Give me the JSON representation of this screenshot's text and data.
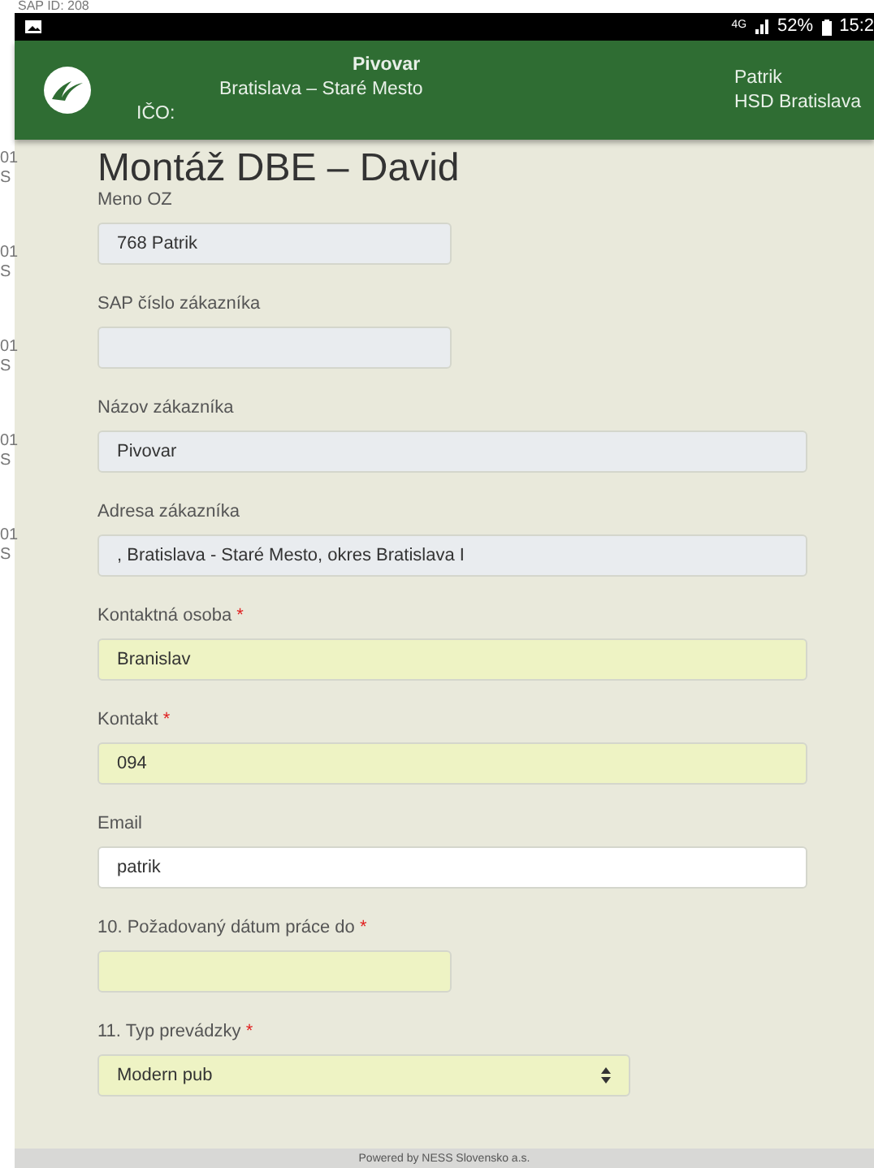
{
  "behind": {
    "title": "SAP ID: 208",
    "fragments": [
      {
        "code": "01",
        "letter": "S"
      },
      {
        "code": "01",
        "letter": "S"
      },
      {
        "code": "01",
        "letter": "S"
      },
      {
        "code": "01",
        "letter": "S"
      },
      {
        "code": "01",
        "letter": "S"
      }
    ]
  },
  "status_bar": {
    "network": "4G",
    "battery": "52%",
    "time": "15:2"
  },
  "header": {
    "title": "Pivovar",
    "address": "Bratislava – Staré Mesto",
    "ico_label": "IČO:",
    "user": "Patrik",
    "branch": "HSD Bratislava"
  },
  "form": {
    "title": "Montáž DBE – David",
    "fields": [
      {
        "kind": "text",
        "label": "Meno OZ",
        "value": "768 Patrik",
        "readonly": true,
        "full_width": false
      },
      {
        "kind": "text",
        "label": "SAP číslo zákazníka",
        "readonly": true,
        "full_width": false
      },
      {
        "kind": "text",
        "label": "Názov zákazníka",
        "value": "Pivovar",
        "readonly": true,
        "full_width": true
      },
      {
        "kind": "text",
        "label": "Adresa zákazníka",
        "value": ", Bratislava - Staré Mesto, okres Bratislava I",
        "readonly": true,
        "full_width": true
      },
      {
        "kind": "text",
        "label": "Kontaktná osoba",
        "required_mark": "*",
        "value": "Branislav",
        "readonly": false,
        "required": true,
        "full_width": true
      },
      {
        "kind": "text",
        "label": "Kontakt",
        "required_mark": "*",
        "value": "094",
        "readonly": false,
        "required": true,
        "full_width": true
      },
      {
        "kind": "text",
        "label": "Email",
        "value": "patrik",
        "readonly": false,
        "required": false,
        "full_width": true
      },
      {
        "kind": "text",
        "label": "10. Požadovaný dátum práce do",
        "required_mark": "*",
        "readonly": false,
        "required": true,
        "full_width": false
      },
      {
        "kind": "select",
        "label": "11. Typ prevádzky",
        "required_mark": "*",
        "value": "Modern pub",
        "readonly": false,
        "required": true,
        "full_width": false
      }
    ]
  },
  "footer": {
    "text": "Powered by NESS Slovensko a.s."
  }
}
